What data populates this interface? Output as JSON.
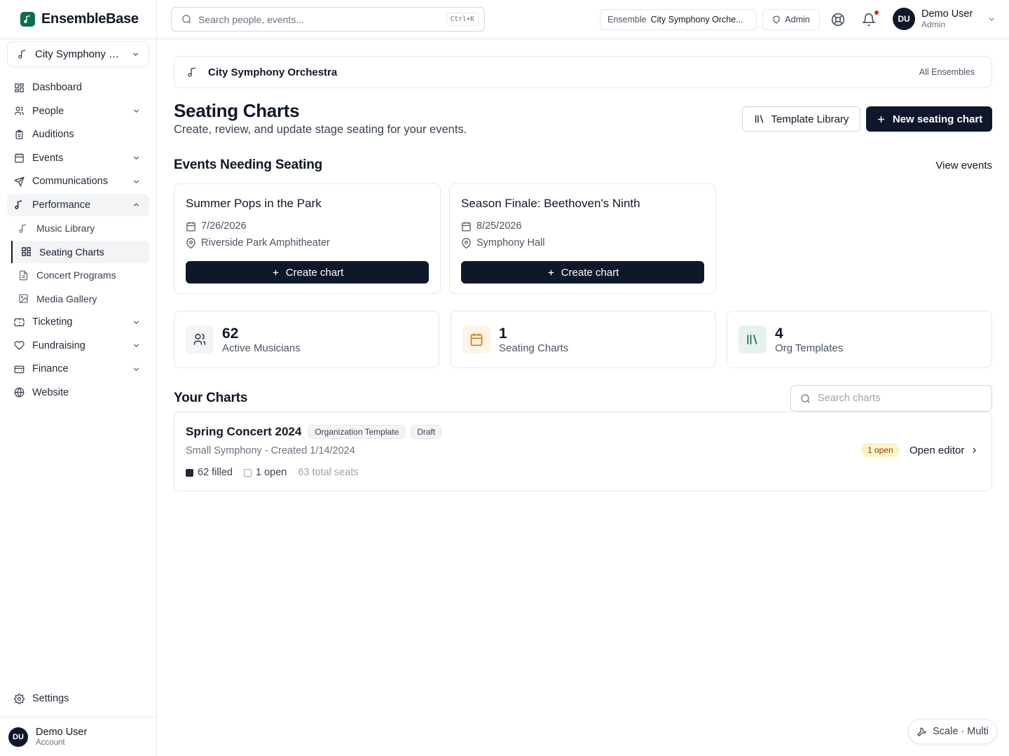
{
  "brand": {
    "name": "EnsembleBase"
  },
  "sidebar": {
    "ensemble_select": "City Symphony O...",
    "items": [
      {
        "label": "Dashboard"
      },
      {
        "label": "People"
      },
      {
        "label": "Auditions"
      },
      {
        "label": "Events"
      },
      {
        "label": "Communications"
      },
      {
        "label": "Performance"
      },
      {
        "label": "Music Library"
      },
      {
        "label": "Seating Charts"
      },
      {
        "label": "Concert Programs"
      },
      {
        "label": "Media Gallery"
      },
      {
        "label": "Ticketing"
      },
      {
        "label": "Fundraising"
      },
      {
        "label": "Finance"
      },
      {
        "label": "Website"
      }
    ],
    "settings": "Settings",
    "account": {
      "initials": "DU",
      "name": "Demo User",
      "sub": "Account"
    }
  },
  "topbar": {
    "search_placeholder": "Search people, events...",
    "shortcut": "Ctrl+K",
    "ensemble_key": "Ensemble",
    "ensemble_value": "City Symphony Orche...",
    "admin": "Admin",
    "user": {
      "initials": "DU",
      "name": "Demo User",
      "role": "Admin"
    }
  },
  "breadcrumb": {
    "name": "City Symphony Orchestra",
    "all": "All Ensembles"
  },
  "page": {
    "title": "Seating Charts",
    "subtitle": "Create, review, and update stage seating for your events.",
    "template_library": "Template Library",
    "new_chart": "New seating chart"
  },
  "events_section": {
    "title": "Events Needing Seating",
    "view_link": "View events",
    "events": [
      {
        "title": "Summer Pops in the Park",
        "date": "7/26/2026",
        "venue": "Riverside Park Amphitheater",
        "button": "Create chart"
      },
      {
        "title": "Season Finale: Beethoven's Ninth",
        "date": "8/25/2026",
        "venue": "Symphony Hall",
        "button": "Create chart"
      }
    ]
  },
  "stats": [
    {
      "value": "62",
      "label": "Active Musicians"
    },
    {
      "value": "1",
      "label": "Seating Charts"
    },
    {
      "value": "4",
      "label": "Org Templates"
    }
  ],
  "charts_section": {
    "title": "Your Charts",
    "search_placeholder": "Search charts",
    "charts": [
      {
        "title": "Spring Concert 2024",
        "badge1": "Organization Template",
        "badge2": "Draft",
        "meta": "Small Symphony - Created 1/14/2024",
        "filled": "62 filled",
        "open": "1 open",
        "total": "63 total seats",
        "open_badge": "1 open",
        "action": "Open editor"
      }
    ]
  },
  "footer_pill": "Scale · Multi",
  "colors": {
    "primary": "#0f172a",
    "brand": "#0f6b4f",
    "accent_amber": "#fef3c7",
    "notification": "#dc2626"
  }
}
